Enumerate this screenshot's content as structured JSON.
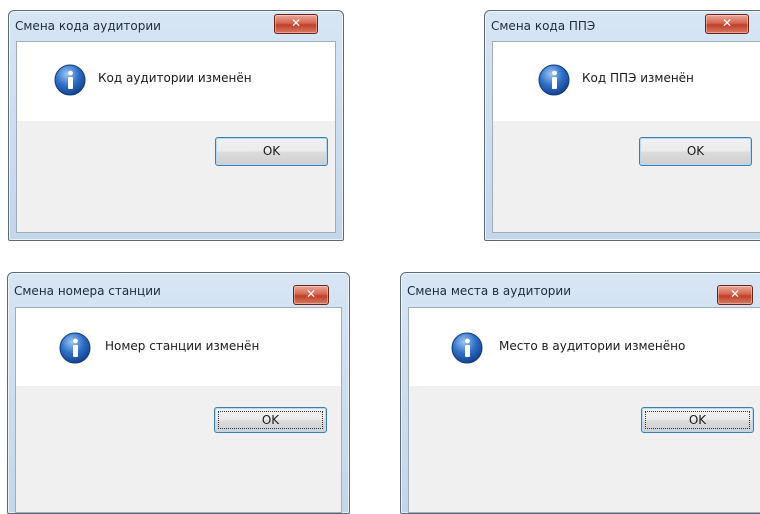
{
  "dialogs": [
    {
      "title": "Смена кода аудитории",
      "message": "Код аудитории изменён",
      "close_glyph": "✕",
      "ok_label": "OK",
      "icon": "info-icon"
    },
    {
      "title": "Смена кода ППЭ",
      "message": "Код ППЭ изменён",
      "close_glyph": "✕",
      "ok_label": "OK",
      "icon": "info-icon"
    },
    {
      "title": "Смена номера станции",
      "message": "Номер станции изменён",
      "close_glyph": "✕",
      "ok_label": "OK",
      "icon": "info-icon"
    },
    {
      "title": "Смена места в аудитории",
      "message": "Место в аудитории изменёно",
      "close_glyph": "✕",
      "ok_label": "OK",
      "icon": "info-icon"
    }
  ],
  "colors": {
    "frame": "#c9daee",
    "close_button": "#c8432d",
    "ok_border": "#3c7fb1",
    "button_area": "#f0f0f0",
    "info_icon": "#1f5fb5"
  }
}
